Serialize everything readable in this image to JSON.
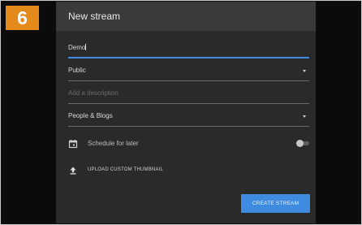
{
  "step_number": "6",
  "dialog": {
    "title": "New stream",
    "title_input": {
      "value": "Demo"
    },
    "visibility_select": {
      "value": "Public"
    },
    "description_input": {
      "placeholder": "Add a description"
    },
    "category_select": {
      "value": "People & Blogs"
    },
    "schedule": {
      "label": "Schedule for later",
      "icon": "calendar-icon",
      "enabled": false
    },
    "upload": {
      "label": "UPLOAD CUSTOM THUMBNAIL",
      "icon": "upload-icon"
    },
    "create_button": {
      "label": "CREATE STREAM"
    }
  },
  "colors": {
    "badge": "#e38a1b",
    "accent": "#3f8be0",
    "dialog_bg": "#2a2a2a",
    "header_bg": "#3a3a3a"
  }
}
